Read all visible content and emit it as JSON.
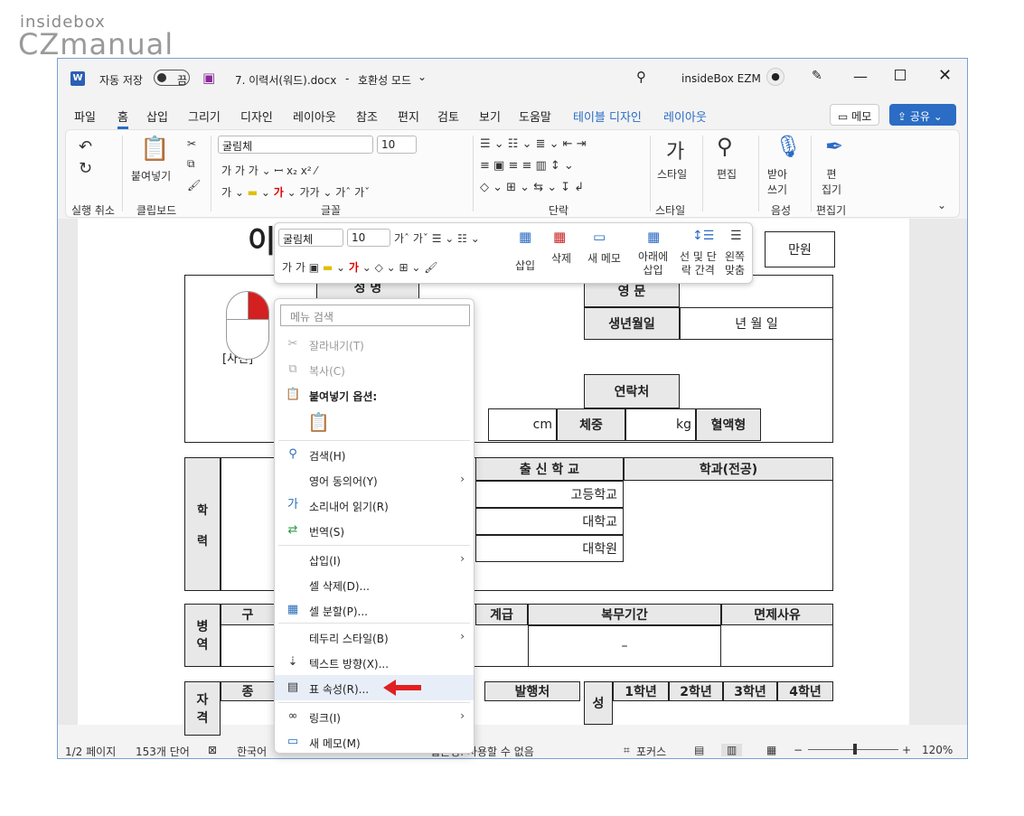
{
  "watermark": {
    "line1": "insidebox",
    "line2": "CZmanual"
  },
  "titlebar": {
    "autosave": "자동 저장",
    "toggle": "끔",
    "filename": "7. 이력서(워드).docx",
    "mode": "호환성 모드",
    "user": "insideBox EZM"
  },
  "tabs": [
    "파일",
    "홈",
    "삽입",
    "그리기",
    "디자인",
    "레이아웃",
    "참조",
    "편지",
    "검토",
    "보기",
    "도움말",
    "테이블 디자인",
    "레이아웃"
  ],
  "buttons": {
    "memo": "메모",
    "share": "공유"
  },
  "ribbon": {
    "groups": [
      "실행 취소",
      "클립보드",
      "글꼴",
      "단락",
      "스타일",
      "음성",
      "편집기"
    ],
    "paste": "붙여넣기",
    "font": "굴림체",
    "size": "10",
    "style": "스타일",
    "edit": "편집",
    "dictate": "받아\n쓰기",
    "editor": "편\n집기"
  },
  "mini": {
    "font": "굴림체",
    "size": "10",
    "insert": "삽입",
    "delete": "삭제",
    "newmemo": "새 메모",
    "insert_below": "아래에\n삽입",
    "spacing": "선 및 단\n락 간격",
    "align": "왼쪽\n맞춤"
  },
  "doc": {
    "cells": {
      "name": "성 명",
      "eng": "영 문",
      "birth": "생년월일",
      "ymd": "년 월 일",
      "contact": "연락처",
      "cm": "cm",
      "weight": "체중",
      "kg": "kg",
      "blood": "혈액형",
      "salary": "만원",
      "photo": "[사진]",
      "school": "출 신 학 교",
      "major": "학과(전공)",
      "hs": "고등학교",
      "univ": "대학교",
      "grad": "대학원",
      "edu": "학\n\n력",
      "mil": "병\n역",
      "gu": "구",
      "rank": "계급",
      "period": "복무기간",
      "exempt": "면제사유",
      "dash": "–",
      "cert": "자\n격",
      "jong": "종",
      "issuer": "발행처",
      "seong": "성",
      "y1": "1학년",
      "y2": "2학년",
      "y3": "3학년",
      "y4": "4학년",
      "big": "이"
    }
  },
  "context_menu": {
    "search_placeholder": "메뉴 검색",
    "items": [
      {
        "label": "잘라내기(T)",
        "disabled": true
      },
      {
        "label": "복사(C)",
        "disabled": true
      },
      {
        "label": "붙여넣기 옵션:",
        "bold": true
      },
      {
        "label": "검색(H)"
      },
      {
        "label": "영어 동의어(Y)",
        "submenu": true
      },
      {
        "label": "소리내어 읽기(R)"
      },
      {
        "label": "번역(S)"
      },
      {
        "label": "삽입(I)",
        "submenu": true
      },
      {
        "label": "셀 삭제(D)..."
      },
      {
        "label": "셀 분할(P)..."
      },
      {
        "label": "테두리 스타일(B)",
        "submenu": true
      },
      {
        "label": "텍스트 방향(X)..."
      },
      {
        "label": "표 속성(R)..."
      },
      {
        "label": "링크(I)",
        "submenu": true
      },
      {
        "label": "새 메모(M)"
      }
    ]
  },
  "status": {
    "page": "1/2 페이지",
    "words": "153개 단어",
    "lang": "한국어",
    "access": "접근성: 사용할 수 없음",
    "focus": "포커스",
    "zoom": "120%"
  },
  "colors": {
    "accent": "#2b6cc4",
    "arrow": "#e02020"
  }
}
